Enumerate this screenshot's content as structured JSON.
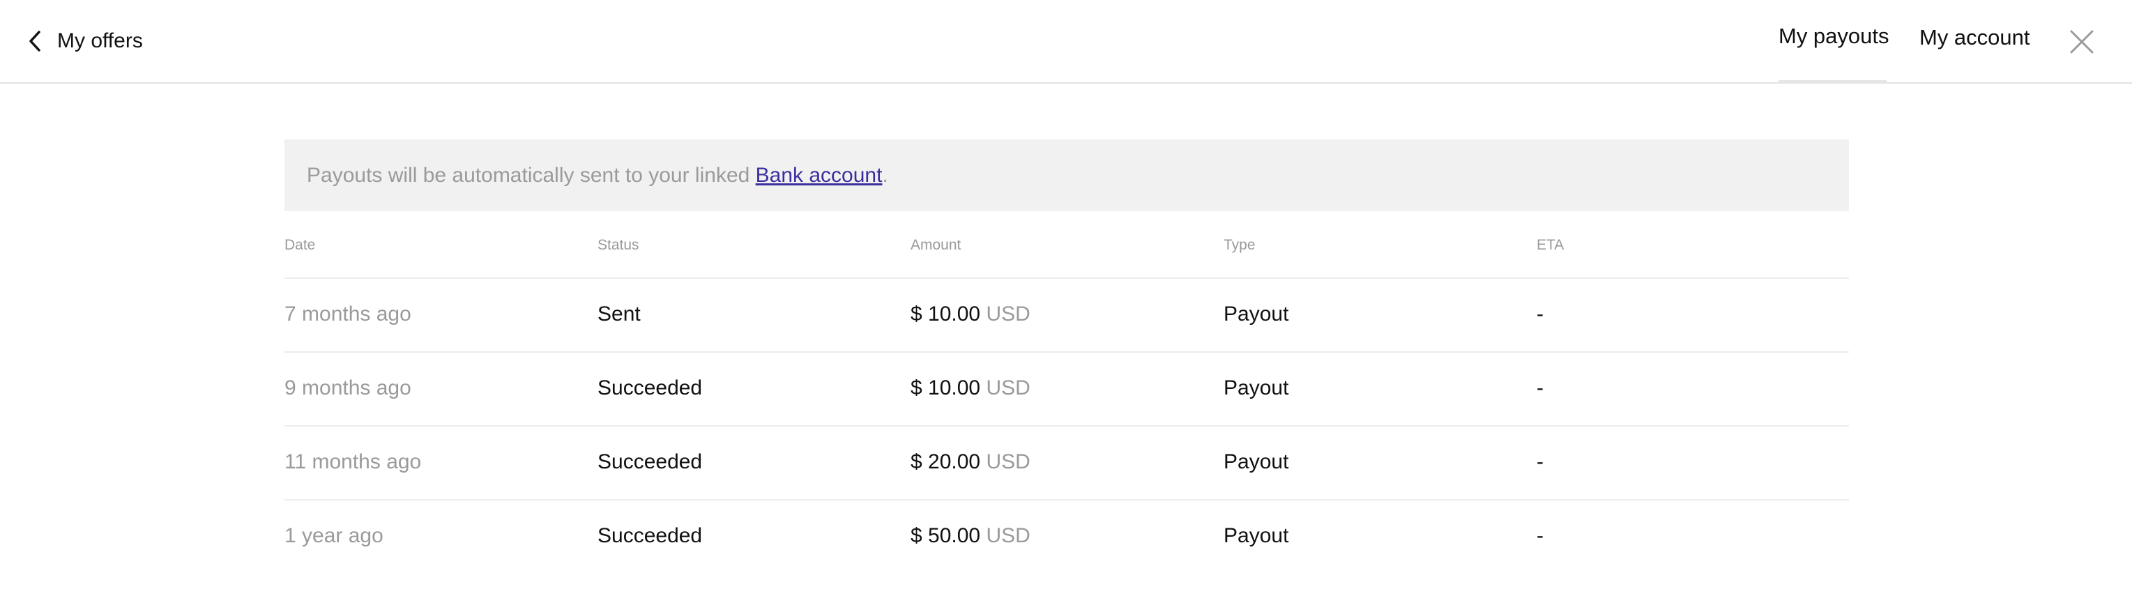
{
  "header": {
    "back_label": "My offers",
    "nav": {
      "payouts": "My payouts",
      "account": "My account"
    }
  },
  "banner": {
    "text_before": "Payouts will be automatically sent to your linked ",
    "link_text": "Bank account",
    "text_after": "."
  },
  "table": {
    "columns": [
      "Date",
      "Status",
      "Amount",
      "Type",
      "ETA"
    ],
    "rows": [
      {
        "date": "7 months ago",
        "status": "Sent",
        "amount": "$ 10.00",
        "currency": "USD",
        "type": "Payout",
        "eta": "-"
      },
      {
        "date": "9 months ago",
        "status": "Succeeded",
        "amount": "$ 10.00",
        "currency": "USD",
        "type": "Payout",
        "eta": "-"
      },
      {
        "date": "11 months ago",
        "status": "Succeeded",
        "amount": "$ 20.00",
        "currency": "USD",
        "type": "Payout",
        "eta": "-"
      },
      {
        "date": "1 year ago",
        "status": "Succeeded",
        "amount": "$ 50.00",
        "currency": "USD",
        "type": "Payout",
        "eta": "-"
      }
    ]
  },
  "icons": {
    "back": "chevron-left-icon",
    "close": "close-icon"
  },
  "colors": {
    "link": "#3a2f9e",
    "muted": "#9a9a9a",
    "banner_bg": "#f1f1f1"
  }
}
